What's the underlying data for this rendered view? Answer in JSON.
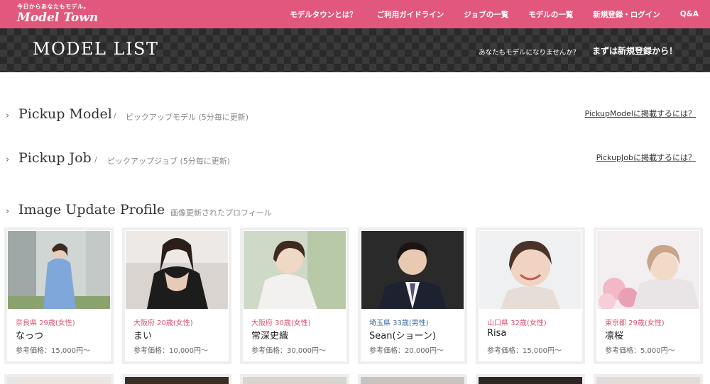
{
  "header": {
    "tagline": "今日からあなたもモデル。",
    "logo_text": "Model Town",
    "nav": [
      "モデルタウンとは？",
      "ご利用ガイドライン",
      "ジョブの一覧",
      "モデルの一覧",
      "新規登録・ログイン",
      "Q&A"
    ]
  },
  "banner": {
    "title": "MODEL LIST",
    "subtitle": "あなたもモデルになりませんか？",
    "cta": "まずは新規登録から！"
  },
  "sections": {
    "pickup_model": {
      "title": "Pickup Model",
      "divider": "/",
      "subtitle": "ピックアップモデル (5分毎に更新)",
      "link": "PickupModelに掲載するには？"
    },
    "pickup_job": {
      "title": "Pickup Job",
      "divider": "/",
      "subtitle": "ピックアップジョブ (5分毎に更新)",
      "link": "PickupJobに掲載するには？"
    },
    "image_update": {
      "title": "Image Update Profile",
      "divider": "/",
      "subtitle": "画像更新されたプロフィール"
    }
  },
  "models": [
    {
      "location": "奈良県 29歳(女性)",
      "name": "なっつ",
      "price": "参考価格：15,000円〜",
      "gender": "female"
    },
    {
      "location": "大阪府 20歳(女性)",
      "name": "まい",
      "price": "参考価格：10,000円〜",
      "gender": "female"
    },
    {
      "location": "大阪府 30歳(女性)",
      "name": "常深史織",
      "price": "参考価格：30,000円〜",
      "gender": "female"
    },
    {
      "location": "埼玉県 33歳(男性)",
      "name": "Sean(ショーン)",
      "price": "参考価格：20,000円〜",
      "gender": "male"
    },
    {
      "location": "山口県 32歳(女性)",
      "name": "Risa",
      "price": "参考価格：15,000円〜",
      "gender": "female"
    },
    {
      "location": "東京都 29歳(女性)",
      "name": "凛桜",
      "price": "参考価格：5,000円〜",
      "gender": "female"
    }
  ],
  "colors": {
    "brand": "#e2587c",
    "female_label": "#d9506f",
    "male_label": "#3d6f9e"
  },
  "icons": {
    "section_marker": "chevron-right-icon"
  }
}
